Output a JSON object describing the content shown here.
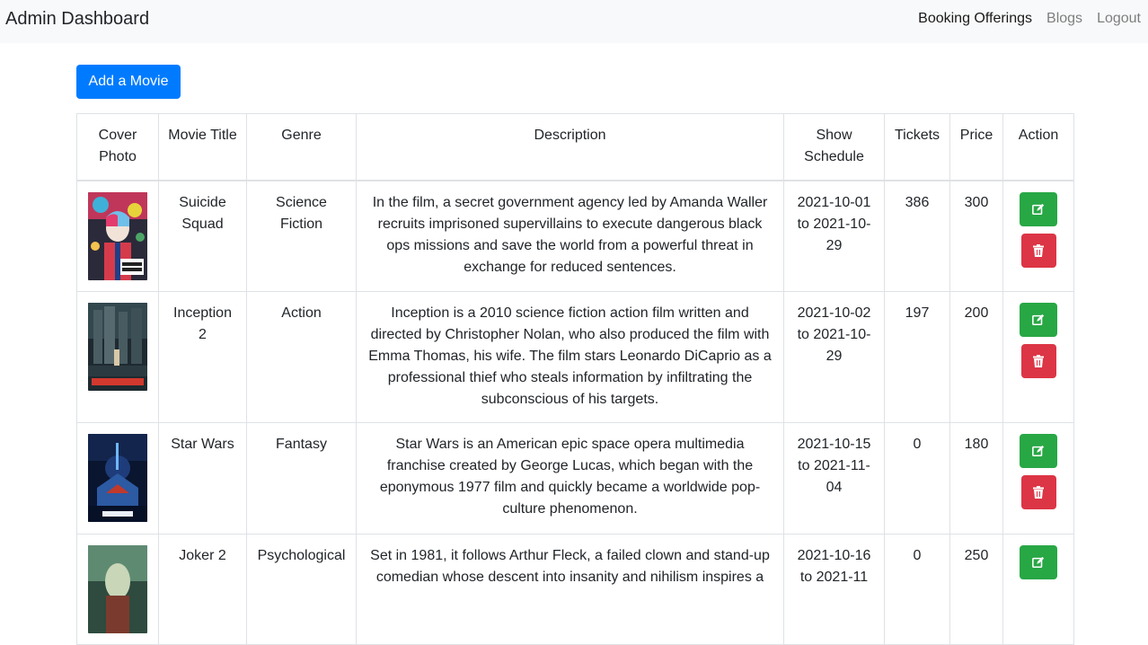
{
  "navbar": {
    "brand": "Admin Dashboard",
    "links": [
      {
        "label": "Booking Offerings",
        "active": true
      },
      {
        "label": "Blogs",
        "active": false
      },
      {
        "label": "Logout",
        "active": false
      }
    ]
  },
  "add_button_label": "Add a Movie",
  "table": {
    "headers": {
      "cover": "Cover Photo",
      "title": "Movie Title",
      "genre": "Genre",
      "description": "Description",
      "schedule": "Show Schedule",
      "tickets": "Tickets",
      "price": "Price",
      "action": "Action"
    },
    "rows": [
      {
        "title": "Suicide Squad",
        "genre": "Science Fiction",
        "description": "In the film, a secret government agency led by Amanda Waller recruits imprisoned supervillains to execute dangerous black ops missions and save the world from a powerful threat in exchange for reduced sentences.",
        "schedule": "2021-10-01 to 2021-10-29",
        "tickets": "386",
        "price": "300"
      },
      {
        "title": "Inception 2",
        "genre": "Action",
        "description": "Inception is a 2010 science fiction action film written and directed by Christopher Nolan, who also produced the film with Emma Thomas, his wife. The film stars Leonardo DiCaprio as a professional thief who steals information by infiltrating the subconscious of his targets.",
        "schedule": "2021-10-02 to 2021-10-29",
        "tickets": "197",
        "price": "200"
      },
      {
        "title": "Star Wars",
        "genre": "Fantasy",
        "description": "Star Wars is an American epic space opera multimedia franchise created by George Lucas, which began with the eponymous 1977 film and quickly became a worldwide pop-culture phenomenon.",
        "schedule": "2021-10-15 to 2021-11-04",
        "tickets": "0",
        "price": "180"
      },
      {
        "title": "Joker 2",
        "genre": "Psychological",
        "description": "Set in 1981, it follows Arthur Fleck, a failed clown and stand-up comedian whose descent into insanity and nihilism inspires a",
        "schedule": "2021-10-16 to 2021-11",
        "tickets": "0",
        "price": "250"
      }
    ]
  },
  "colors": {
    "primary": "#007bff",
    "success": "#28a745",
    "danger": "#dc3545",
    "navbar_bg": "#f8f9fa",
    "border": "#dee2e6"
  },
  "icons": {
    "edit": "edit-icon",
    "delete": "trash-icon"
  }
}
